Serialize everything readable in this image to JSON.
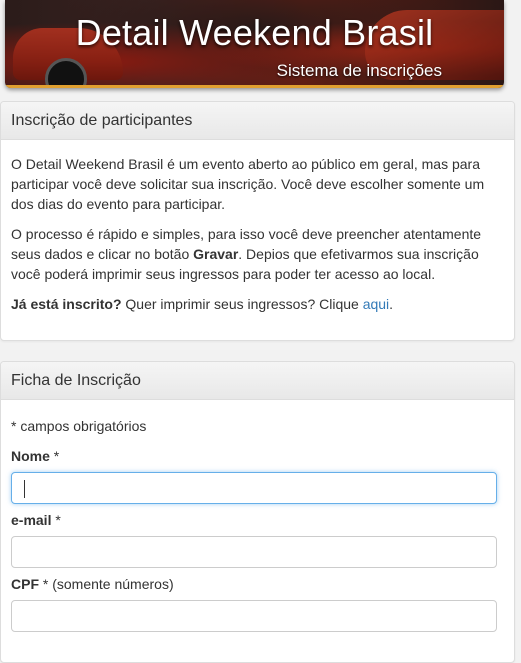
{
  "banner": {
    "title": "Detail Weekend Brasil",
    "subtitle": "Sistema de inscrições"
  },
  "info_panel": {
    "heading": "Inscrição de participantes",
    "paragraph1": "O Detail Weekend Brasil é um evento aberto ao público em geral, mas para participar você deve solicitar sua inscrição. Você deve escolher somente um dos dias do evento para participar.",
    "paragraph2_before": "O processo é rápido e simples, para isso você deve preencher atentamente seus dados e clicar no botão ",
    "paragraph2_bold": "Gravar",
    "paragraph2_after": ". Depios que efetivarmos sua inscrição você poderá imprimir seus ingressos para poder ter acesso ao local.",
    "question_bold": "Já está inscrito?",
    "question_text": " Quer imprimir seus ingressos? Clique ",
    "link_text": "aqui",
    "question_end": "."
  },
  "form_panel": {
    "heading": "Ficha de Inscrição",
    "required_note": "* campos obrigatórios",
    "fields": [
      {
        "label": "Nome",
        "suffix": " *",
        "hint": "",
        "value": ""
      },
      {
        "label": "e-mail",
        "suffix": " *",
        "hint": "",
        "value": ""
      },
      {
        "label": "CPF",
        "suffix": " *",
        "hint": " (somente números)",
        "value": ""
      }
    ]
  }
}
